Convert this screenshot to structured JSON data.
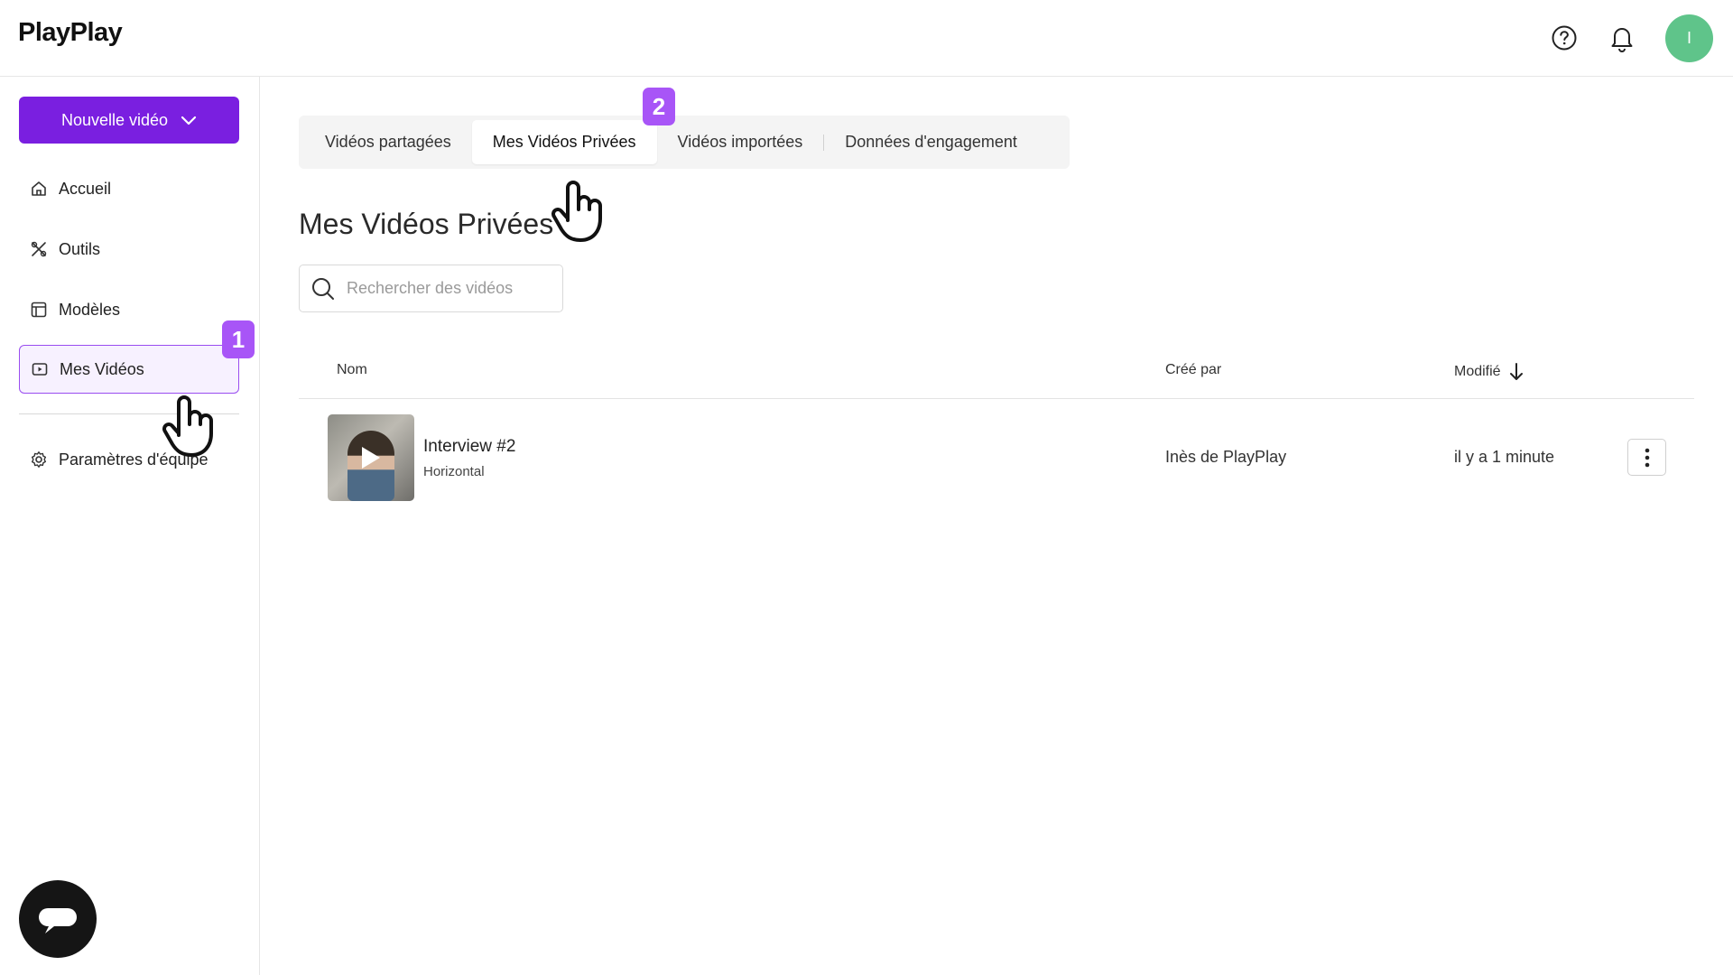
{
  "header": {
    "logo": "PlayPlay",
    "avatar_initial": "I",
    "avatar_color": "#5fc48a"
  },
  "sidebar": {
    "new_video_label": "Nouvelle vidéo",
    "items": [
      {
        "label": "Accueil",
        "icon": "home-icon"
      },
      {
        "label": "Outils",
        "icon": "tools-icon"
      },
      {
        "label": "Modèles",
        "icon": "templates-icon"
      },
      {
        "label": "Mes Vidéos",
        "icon": "video-icon",
        "active": true
      },
      {
        "label": "Paramètres d'équipe",
        "icon": "gear-icon"
      }
    ]
  },
  "steps": {
    "step1": "1",
    "step2": "2"
  },
  "tabs": [
    {
      "label": "Vidéos partagées"
    },
    {
      "label": "Mes Vidéos Privées",
      "active": true
    },
    {
      "label": "Vidéos importées"
    },
    {
      "label": "Données d'engagement"
    }
  ],
  "main": {
    "title": "Mes Vidéos Privées",
    "search_placeholder": "Rechercher des vidéos",
    "columns": {
      "name": "Nom",
      "created_by": "Créé par",
      "modified": "Modifié"
    },
    "videos": [
      {
        "name": "Interview #2",
        "format": "Horizontal",
        "created_by": "Inès de PlayPlay",
        "modified": "il y a 1 minute"
      }
    ]
  },
  "colors": {
    "accent": "#7a1fe0",
    "badge": "#a855f7"
  }
}
